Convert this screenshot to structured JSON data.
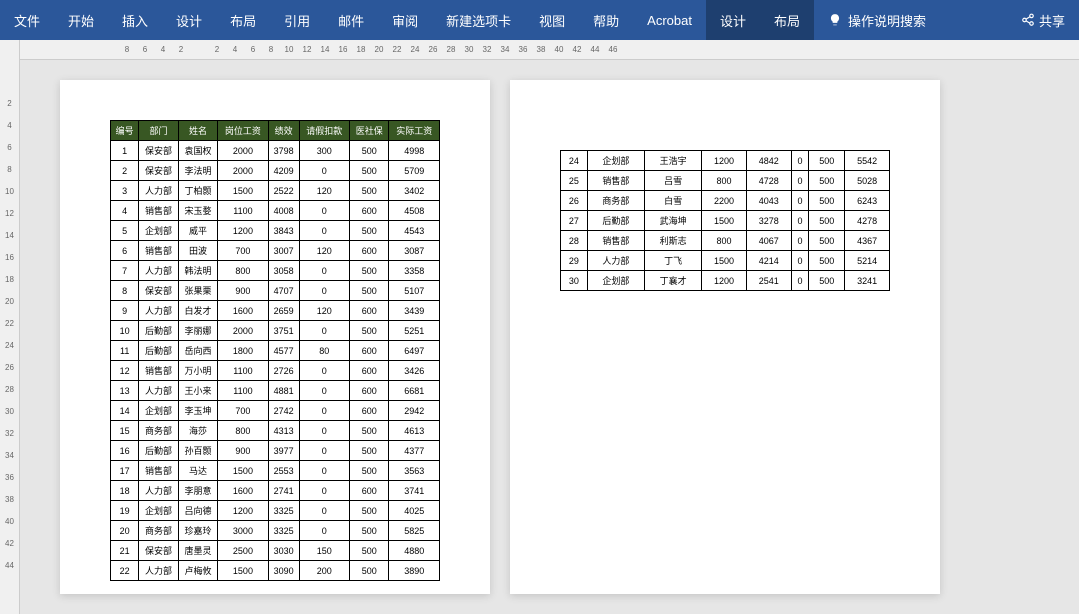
{
  "ribbon": {
    "tabs": [
      "文件",
      "开始",
      "插入",
      "设计",
      "布局",
      "引用",
      "邮件",
      "审阅",
      "新建选项卡",
      "视图",
      "帮助",
      "Acrobat",
      "设计",
      "布局"
    ],
    "active_indices": [
      12,
      13
    ],
    "search_placeholder": "操作说明搜索",
    "share_label": "共享"
  },
  "ruler_h": [
    "8",
    "6",
    "4",
    "2",
    "",
    "2",
    "4",
    "6",
    "8",
    "10",
    "12",
    "14",
    "16",
    "18",
    "20",
    "22",
    "24",
    "26",
    "28",
    "30",
    "32",
    "34",
    "36",
    "38",
    "40",
    "42",
    "44",
    "46"
  ],
  "ruler_v": [
    "",
    "2",
    "4",
    "6",
    "8",
    "10",
    "12",
    "14",
    "16",
    "18",
    "20",
    "22",
    "24",
    "26",
    "28",
    "30",
    "32",
    "34",
    "36",
    "38",
    "40",
    "42",
    "44"
  ],
  "table": {
    "headers": [
      "编号",
      "部门",
      "姓名",
      "岗位工资",
      "绩效",
      "请假扣款",
      "医社保",
      "实际工资"
    ],
    "rows_page1": [
      [
        "1",
        "保安部",
        "袁国权",
        "2000",
        "3798",
        "300",
        "500",
        "4998"
      ],
      [
        "2",
        "保安部",
        "李法明",
        "2000",
        "4209",
        "0",
        "500",
        "5709"
      ],
      [
        "3",
        "人力部",
        "丁柏颢",
        "1500",
        "2522",
        "120",
        "500",
        "3402"
      ],
      [
        "4",
        "销售部",
        "宋玉婺",
        "1100",
        "4008",
        "0",
        "600",
        "4508"
      ],
      [
        "5",
        "企划部",
        "威平",
        "1200",
        "3843",
        "0",
        "500",
        "4543"
      ],
      [
        "6",
        "销售部",
        "田波",
        "700",
        "3007",
        "120",
        "600",
        "3087"
      ],
      [
        "7",
        "人力部",
        "韩法明",
        "800",
        "3058",
        "0",
        "500",
        "3358"
      ],
      [
        "8",
        "保安部",
        "张果栗",
        "900",
        "4707",
        "0",
        "500",
        "5107"
      ],
      [
        "9",
        "人力部",
        "白发才",
        "1600",
        "2659",
        "120",
        "600",
        "3439"
      ],
      [
        "10",
        "后勤部",
        "李丽娜",
        "2000",
        "3751",
        "0",
        "500",
        "5251"
      ],
      [
        "11",
        "后勤部",
        "岳向西",
        "1800",
        "4577",
        "80",
        "600",
        "6497"
      ],
      [
        "12",
        "销售部",
        "万小明",
        "1100",
        "2726",
        "0",
        "600",
        "3426"
      ],
      [
        "13",
        "人力部",
        "王小来",
        "1100",
        "4881",
        "0",
        "600",
        "6681"
      ],
      [
        "14",
        "企划部",
        "李玉坤",
        "700",
        "2742",
        "0",
        "600",
        "2942"
      ],
      [
        "15",
        "商务部",
        "海莎",
        "800",
        "4313",
        "0",
        "500",
        "4613"
      ],
      [
        "16",
        "后勤部",
        "孙百颢",
        "900",
        "3977",
        "0",
        "500",
        "4377"
      ],
      [
        "17",
        "销售部",
        "马达",
        "1500",
        "2553",
        "0",
        "500",
        "3563"
      ],
      [
        "18",
        "人力部",
        "李朋意",
        "1600",
        "2741",
        "0",
        "600",
        "3741"
      ],
      [
        "19",
        "企划部",
        "吕向德",
        "1200",
        "3325",
        "0",
        "500",
        "4025"
      ],
      [
        "20",
        "商务部",
        "珍嘉玲",
        "3000",
        "3325",
        "0",
        "500",
        "5825"
      ],
      [
        "21",
        "保安部",
        "唐墨灵",
        "2500",
        "3030",
        "150",
        "500",
        "4880"
      ],
      [
        "22",
        "人力部",
        "卢梅攸",
        "1500",
        "3090",
        "200",
        "500",
        "3890"
      ]
    ],
    "rows_page2": [
      [
        "24",
        "企划部",
        "王浩宇",
        "1200",
        "4842",
        "0",
        "500",
        "5542"
      ],
      [
        "25",
        "销售部",
        "吕雪",
        "800",
        "4728",
        "0",
        "500",
        "5028"
      ],
      [
        "26",
        "商务部",
        "白雪",
        "2200",
        "4043",
        "0",
        "500",
        "6243"
      ],
      [
        "27",
        "后勤部",
        "武海坤",
        "1500",
        "3278",
        "0",
        "500",
        "4278"
      ],
      [
        "28",
        "销售部",
        "利斯志",
        "800",
        "4067",
        "0",
        "500",
        "4367"
      ],
      [
        "29",
        "人力部",
        "丁飞",
        "1500",
        "4214",
        "0",
        "500",
        "5214"
      ],
      [
        "30",
        "企划部",
        "丁襄才",
        "1200",
        "2541",
        "0",
        "500",
        "3241"
      ]
    ]
  }
}
